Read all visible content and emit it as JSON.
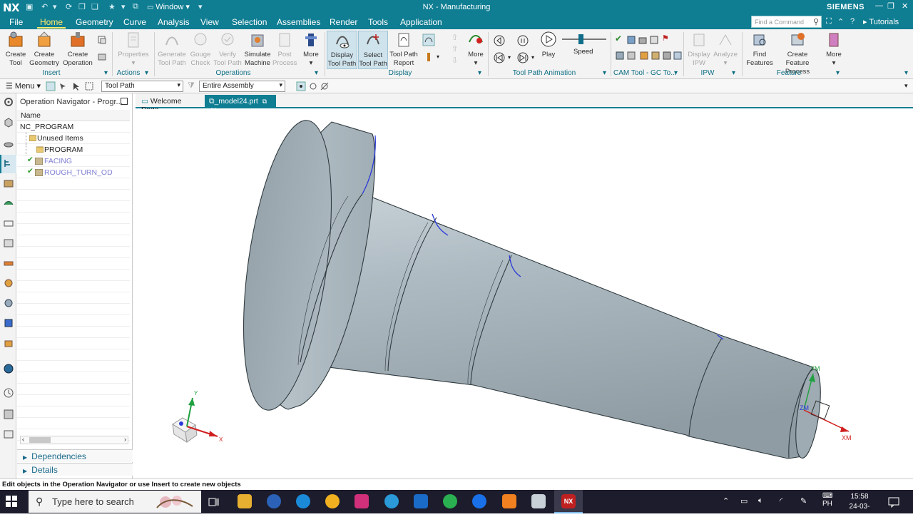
{
  "titlebar": {
    "logo": "NX",
    "window_menu": "Window ▾",
    "title": "NX - Manufacturing",
    "brand": "SIEMENS"
  },
  "menubar": {
    "tabs": [
      "File",
      "Home",
      "Geometry",
      "Curve",
      "Analysis",
      "View",
      "Selection",
      "Assemblies",
      "Render",
      "Tools",
      "Application"
    ],
    "active_tab": "Home",
    "search_placeholder": "Find a Command",
    "tutorials": "Tutorials"
  },
  "ribbon": {
    "insert": {
      "create_tool": "Create Tool",
      "create_geometry": "Create Geometry",
      "create_operation": "Create Operation",
      "label": "Insert"
    },
    "actions": {
      "properties": "Properties",
      "label": "Actions"
    },
    "operations": {
      "generate_tool_path": "Generate Tool Path",
      "gouge_check": "Gouge Check",
      "verify_tool_path": "Verify Tool Path",
      "simulate_machine": "Simulate Machine",
      "post_process": "Post Process",
      "more": "More",
      "label": "Operations"
    },
    "display": {
      "display_tool_path": "Display Tool Path",
      "select_tool_path": "Select Tool Path",
      "tool_path_report": "Tool Path Report",
      "more": "More",
      "label": "Display"
    },
    "animation": {
      "play": "Play",
      "speed": "Speed",
      "speed_value": 0.45,
      "label": "Tool Path Animation"
    },
    "cam_tool": {
      "label": "CAM Tool - GC To..."
    },
    "ipw": {
      "display_ipw": "Display IPW",
      "analyze": "Analyze",
      "label": "IPW"
    },
    "feature": {
      "find_features": "Find Features",
      "create_feature_process": "Create Feature Process",
      "more": "More",
      "label": "Feature"
    }
  },
  "toolbar": {
    "menu": "Menu ▾",
    "filter": "Tool Path",
    "scope": "Entire Assembly"
  },
  "navigator": {
    "title": "Operation Navigator - Progr...",
    "column": "Name",
    "rows": [
      "NC_PROGRAM",
      "Unused Items",
      "PROGRAM",
      "FACING",
      "ROUGH_TURN_OD"
    ],
    "panels": [
      "Dependencies",
      "Details"
    ]
  },
  "tabs": {
    "welcome": "Welcome Page",
    "model": "_model24.prt"
  },
  "triad": {
    "x": "X",
    "y": "Y",
    "xm": "XM",
    "ym": "YM",
    "zm": "ZM"
  },
  "status": "Edit objects in the Operation Navigator or use Insert to create new objects",
  "taskbar": {
    "search": "Type here to search",
    "time": "15:58",
    "date": "24-03-2024",
    "lang": "PH"
  },
  "colors": {
    "titlebar": "#0f7d92",
    "active_tab": "#ffeb6b",
    "part": "#a9b7bf",
    "taskbar": "#1c1c2c"
  }
}
